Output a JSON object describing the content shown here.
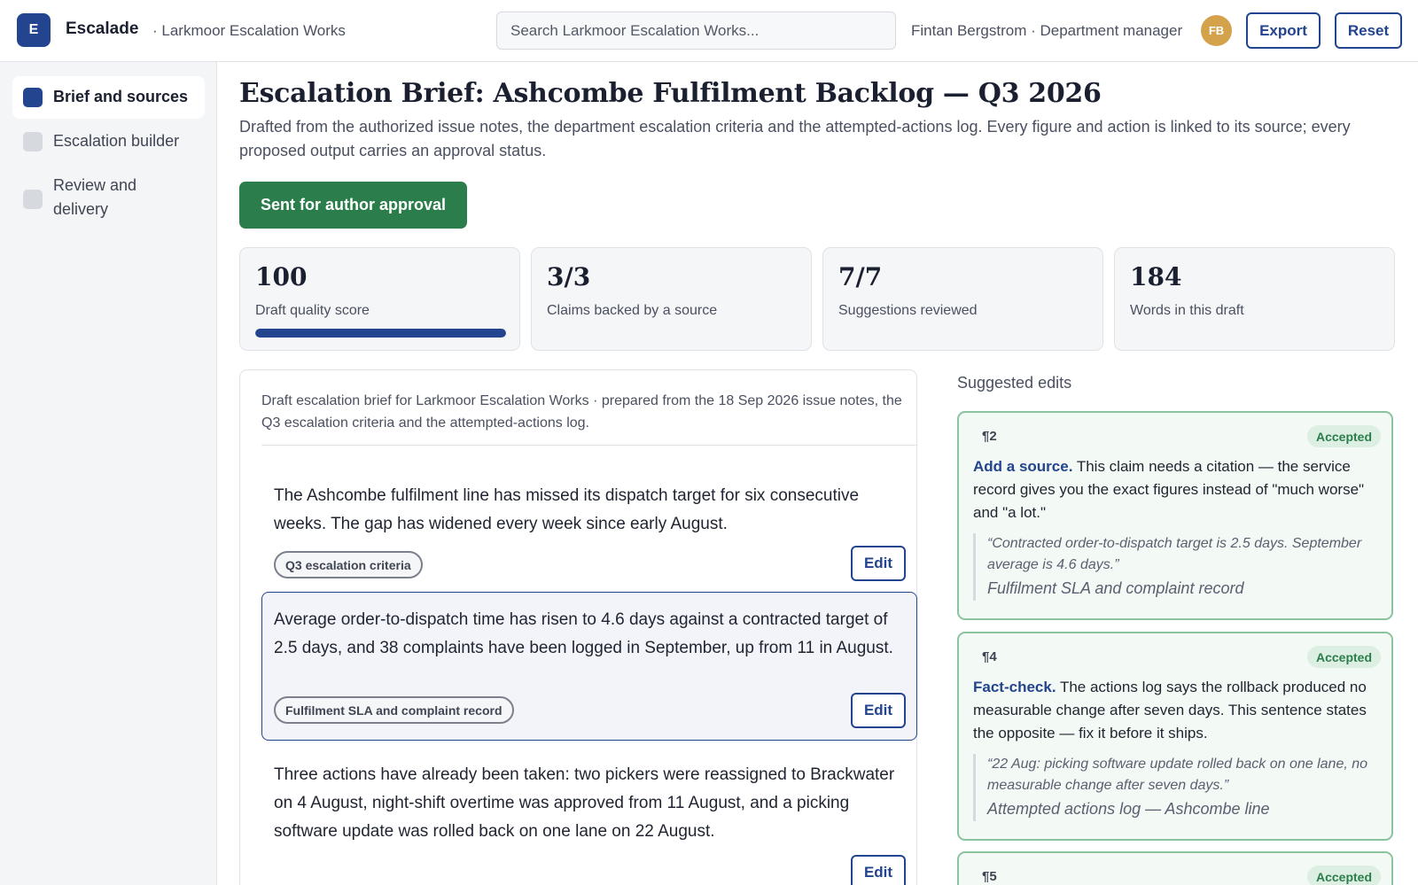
{
  "topbar": {
    "logo_letter": "E",
    "app_name": "Escalade",
    "org": "· Larkmoor Escalation Works",
    "search_placeholder": "Search Larkmoor Escalation Works...",
    "user": "Fintan Bergstrom · Department manager",
    "avatar_initials": "FB",
    "export_label": "Export",
    "reset_label": "Reset"
  },
  "sidebar": {
    "items": [
      {
        "label": "Brief and sources",
        "active": true
      },
      {
        "label": "Escalation builder",
        "active": false
      },
      {
        "label": "Review and delivery",
        "active": false
      }
    ]
  },
  "main": {
    "title": "Escalation Brief: Ashcombe Fulfilment Backlog — Q3 2026",
    "subtitle": "Drafted from the authorized issue notes, the department escalation criteria and the attempted-actions log. Every figure and action is linked to its source; every proposed output carries an approval status.",
    "status_button": "Sent for author approval"
  },
  "stats": [
    {
      "value": "100",
      "label": "Draft quality score",
      "progress": 1.0
    },
    {
      "value": "3/3",
      "label": "Claims backed by a source"
    },
    {
      "value": "7/7",
      "label": "Suggestions reviewed"
    },
    {
      "value": "184",
      "label": "Words in this draft"
    }
  ],
  "draft": {
    "header": "Draft escalation brief for Larkmoor Escalation Works · prepared from the 18 Sep 2026 issue notes, the Q3 escalation criteria and the attempted-actions log.",
    "edit_label": "Edit",
    "paragraphs": [
      {
        "text": "The Ashcombe fulfilment line has missed its dispatch target for six consecutive weeks. The gap has widened every week since early August.",
        "source": "Q3 escalation criteria"
      },
      {
        "text": "Average order-to-dispatch time has risen to 4.6 days against a contracted target of 2.5 days, and 38 complaints have been logged in September, up from 11 in August.",
        "source": "Fulfilment SLA and complaint record"
      },
      {
        "text": "Three actions have already been taken: two pickers were reassigned to Brackwater on 4 August, night-shift overtime was approved from 11 August, and a picking software update was rolled back on one lane on 22 August."
      }
    ]
  },
  "suggestions": {
    "heading": "Suggested edits",
    "items": [
      {
        "para": "¶2",
        "status": "Accepted",
        "action": "Add a source.",
        "body": " This claim needs a citation — the service record gives you the exact figures instead of \"much worse\" and \"a lot.\"",
        "quote": "“Contracted order-to-dispatch target is 2.5 days. September average is 4.6 days.”",
        "source": "Fulfilment SLA and complaint record"
      },
      {
        "para": "¶4",
        "status": "Accepted",
        "action": "Fact-check.",
        "body": " The actions log says the rollback produced no measurable change after seven days. This sentence states the opposite — fix it before it ships.",
        "quote": "“22 Aug: picking software update rolled back on one lane, no measurable change after seven days.”",
        "source": "Attempted actions log — Ashcombe line"
      },
      {
        "para": "¶5",
        "status": "Accepted"
      }
    ]
  },
  "colors": {
    "accent": "#23448f",
    "success": "#2b7d4b",
    "avatar": "#d3a24a"
  }
}
